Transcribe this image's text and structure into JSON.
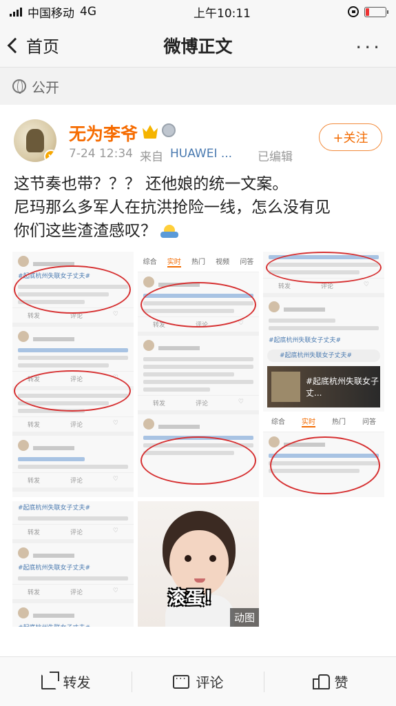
{
  "status_bar": {
    "carrier": "中国移动",
    "network": "4G",
    "time": "上午10:11",
    "battery_level": 0.15
  },
  "nav": {
    "back_label": "首页",
    "title": "微博正文",
    "more": "···"
  },
  "visibility": {
    "label": "公开"
  },
  "post": {
    "username": "无为李爷",
    "date": "7-24 12:34",
    "source_prefix": "来自",
    "source": "HUAWEI ...",
    "edited": "已编辑",
    "follow_label": "+关注",
    "text_lines": [
      "这节奏也带？？？ 还他娘的统一文案。",
      "尼玛那么多军人在抗洪抢险一线，怎么没有见",
      "你们这些渣渣感叹？"
    ]
  },
  "images": {
    "gif_badge": "动图",
    "gif_caption": "滚蛋！",
    "screenshot_tabs": [
      "综合",
      "实时",
      "热门",
      "视频",
      "问答"
    ],
    "screenshot_hashtag": "#起底杭州失联女子丈夫#",
    "screenshot_banner": "#起底杭州失联女子丈...",
    "screenshot_action_share": "转发",
    "screenshot_action_comment": "评论"
  },
  "toolbar": {
    "repost": "转发",
    "comment": "评论",
    "like": "赞"
  }
}
